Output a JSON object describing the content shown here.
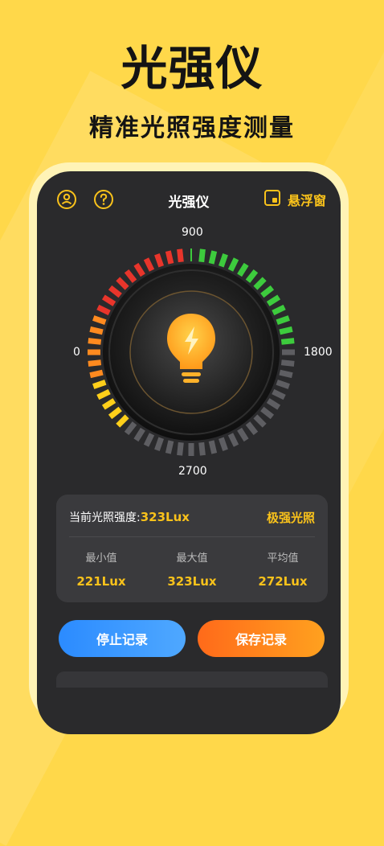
{
  "promo": {
    "headline": "光强仪",
    "subheadline": "精准光照强度测量"
  },
  "app": {
    "title": "光强仪",
    "float_label": "悬浮窗",
    "icons": [
      "user-circle-icon",
      "help-icon",
      "floating-window-icon",
      "lightbulb-icon"
    ]
  },
  "gauge": {
    "labels": {
      "top": "900",
      "right": "1800",
      "bottom": "2700",
      "left": "0"
    },
    "min": 0,
    "max": 3600,
    "current": 323,
    "colors": {
      "red": "#E8352B",
      "orange": "#FF8A1F",
      "yellow": "#FFCF1A",
      "green": "#3DCB3D",
      "inactive": "#5E5E62"
    }
  },
  "stats": {
    "current_label": "当前光照强度:",
    "current_value": "323Lux",
    "level": "极强光照",
    "min_label": "最小值",
    "min_value": "221Lux",
    "max_label": "最大值",
    "max_value": "323Lux",
    "avg_label": "平均值",
    "avg_value": "272Lux"
  },
  "buttons": {
    "stop": "停止记录",
    "save": "保存记录"
  }
}
